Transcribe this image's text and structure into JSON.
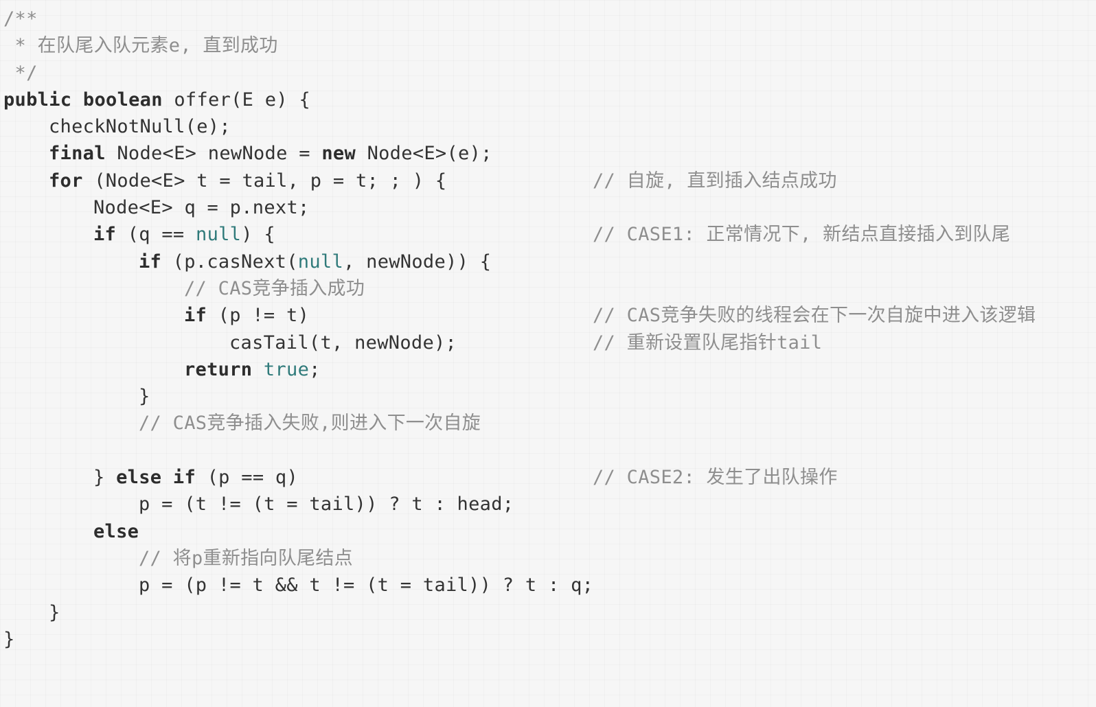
{
  "code": {
    "doc_open": "/**",
    "doc_body": " * 在队尾入队元素e, 直到成功",
    "doc_close": " */",
    "l4_kw1": "public",
    "l4_kw2": "boolean",
    "l4_rest": " offer(E e) {",
    "l5": "checkNotNull(e);",
    "l6_kw1": "final",
    "l6_mid": " Node<E> newNode = ",
    "l6_kw2": "new",
    "l6_rest": " Node<E>(e);",
    "l7_kw": "for",
    "l7_rest": " (Node<E> t = tail, p = t; ; ) {",
    "l7_cm": "// 自旋, 直到插入结点成功",
    "l8": "Node<E> q = p.next;",
    "l9_kw": "if",
    "l9_pre": " (q == ",
    "l9_lit": "null",
    "l9_post": ") {",
    "l9_cm": "// CASE1: 正常情况下, 新结点直接插入到队尾",
    "l10_kw": "if",
    "l10_pre": " (p.casNext(",
    "l10_lit": "null",
    "l10_post": ", newNode)) {",
    "l11_cm": "// CAS竞争插入成功",
    "l12_kw": "if",
    "l12_rest": " (p != t)",
    "l12_cm": "// CAS竞争失败的线程会在下一次自旋中进入该逻辑",
    "l13": "casTail(t, newNode);",
    "l13_cm": "// 重新设置队尾指针tail",
    "l14_kw": "return",
    "l14_lit": "true",
    "l14_post": ";",
    "l15": "}",
    "l16_cm": "// CAS竞争插入失败,则进入下一次自旋",
    "l18_pre": "} ",
    "l18_kw1": "else",
    "l18_kw2": "if",
    "l18_rest": " (p == q)",
    "l18_cm": "// CASE2: 发生了出队操作",
    "l19": "p = (t != (t = tail)) ? t : head;",
    "l20_kw": "else",
    "l21_cm": "// 将p重新指向队尾结点",
    "l22": "p = (p != t && t != (t = tail)) ? t : q;",
    "l23": "}",
    "l24": "}"
  }
}
